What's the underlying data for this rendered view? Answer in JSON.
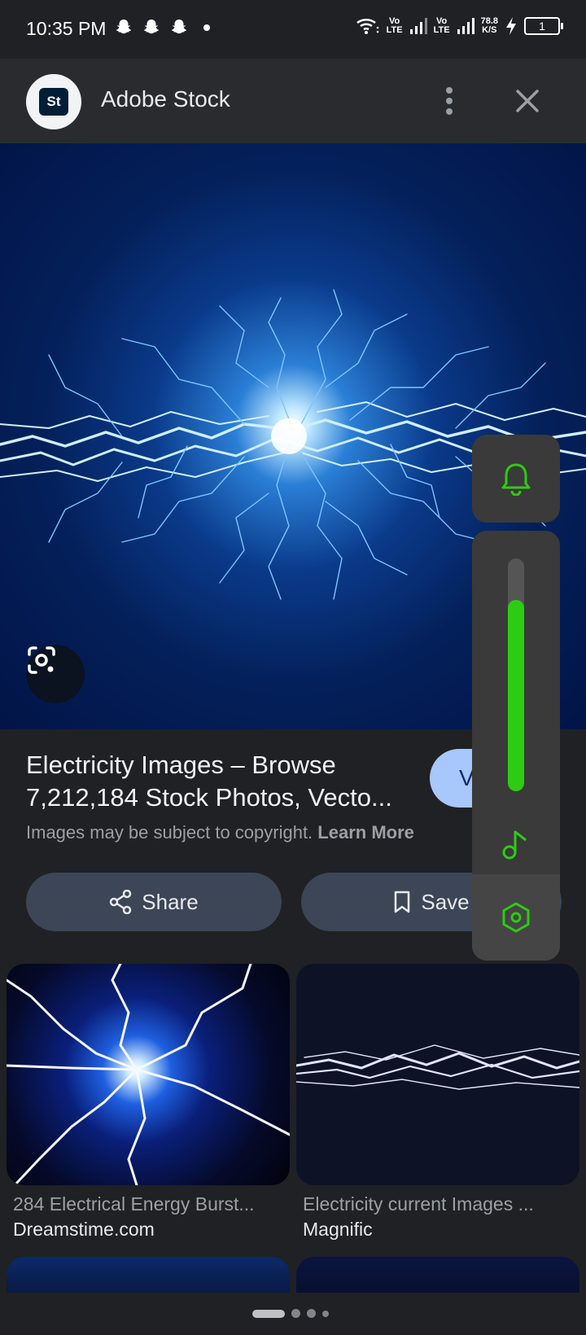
{
  "status_bar": {
    "time": "10:35 PM",
    "net1": "Vo\nLTE",
    "net2": "Vo\nLTE",
    "speed": "78.8\nK/S",
    "battery": "1"
  },
  "header": {
    "logo_text": "St",
    "site_name": "Adobe Stock"
  },
  "result": {
    "title": "Electricity Images – Browse 7,212,184 Stock Photos, Vecto...",
    "visit_label": "V",
    "copyright_text": "Images may be subject to copyright.",
    "learn_more": "Learn More",
    "share_label": "Share",
    "save_label": "Save"
  },
  "related": [
    {
      "title": "284 Electrical Energy Burst...",
      "source": "Dreamstime.com"
    },
    {
      "title": "Electricity current Images ...",
      "source": "Magnific"
    }
  ],
  "volume": {
    "level_percent": 82,
    "accent": "#2dcc12"
  }
}
